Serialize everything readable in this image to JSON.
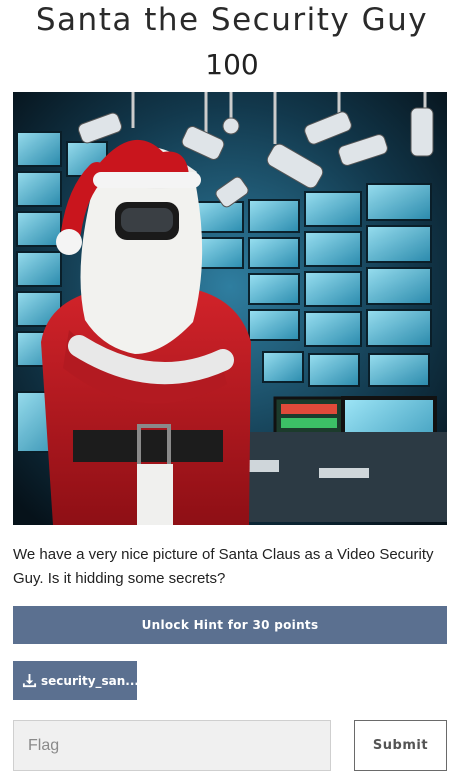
{
  "challenge": {
    "title": "Santa the Security Guy",
    "points": "100",
    "description": "We have a very nice picture of Santa Claus as a Video Security Guy. Is it hidding some secrets?"
  },
  "image": {
    "alt": "Santa Claus wearing a VR-style visor standing in a security control room full of monitors and CCTV cameras"
  },
  "actions": {
    "hint_label": "Unlock Hint for 30 points",
    "file_label": "security_san...",
    "file_icon": "download-icon"
  },
  "form": {
    "flag_placeholder": "Flag",
    "flag_value": "",
    "submit_label": "Submit"
  },
  "colors": {
    "button": "#5b7090",
    "text": "#222222"
  }
}
